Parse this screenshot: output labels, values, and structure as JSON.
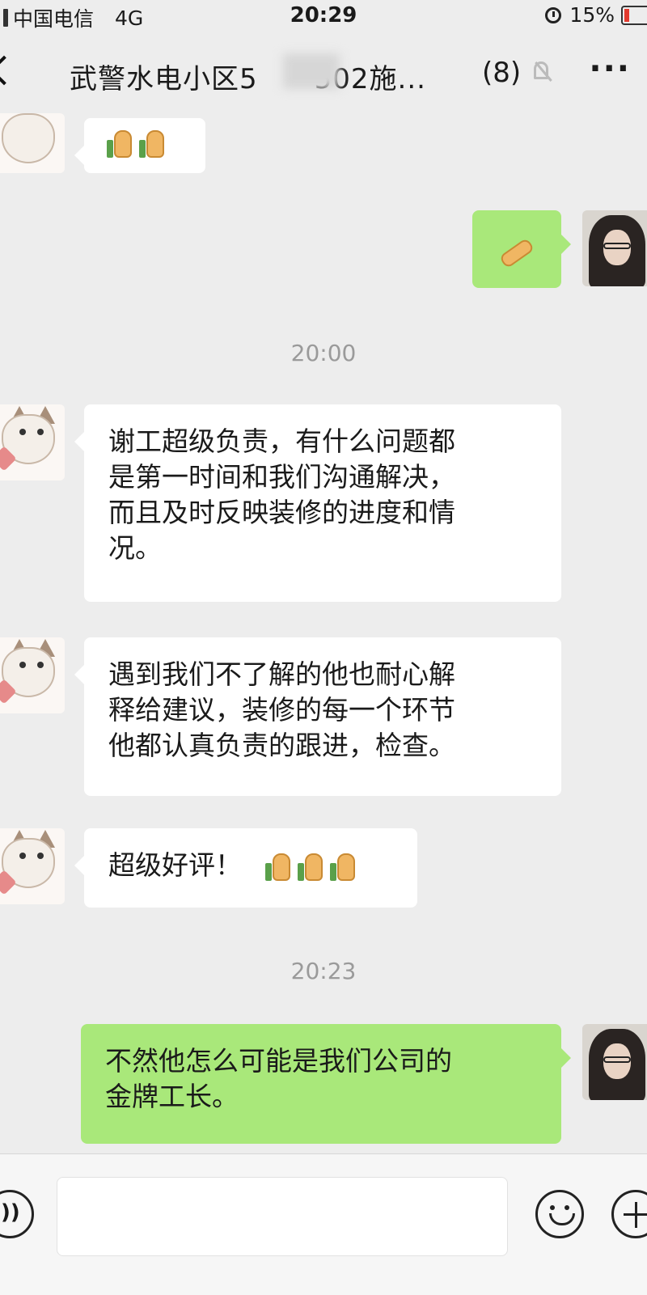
{
  "status_bar": {
    "carrier": "中国电信",
    "network": "4G",
    "time": "20:29",
    "battery": "15%"
  },
  "nav": {
    "title": "武警水电小区5",
    "title_suffix": "502施...",
    "member_count": "(8)"
  },
  "timestamps": [
    "20:00",
    "20:23"
  ],
  "messages": [
    {
      "sender": "other",
      "text": "谢工超级负责，有什么问题都\n是第一时间和我们沟通解决，\n而且及时反映装修的进度和情\n况。"
    },
    {
      "sender": "other",
      "text": "遇到我们不了解的他也耐心解\n释给建议，装修的每一个环节\n他都认真负责的跟进，检查。"
    },
    {
      "sender": "other",
      "text": "超级好评！"
    },
    {
      "sender": "self",
      "text": "不然他怎么可能是我们公司的\n金牌工长。"
    }
  ],
  "icons": [
    "back-icon",
    "mute-icon",
    "more-icon",
    "thumbs-up-icon",
    "hand-icon",
    "voice-icon",
    "emoji-icon",
    "plus-icon"
  ]
}
